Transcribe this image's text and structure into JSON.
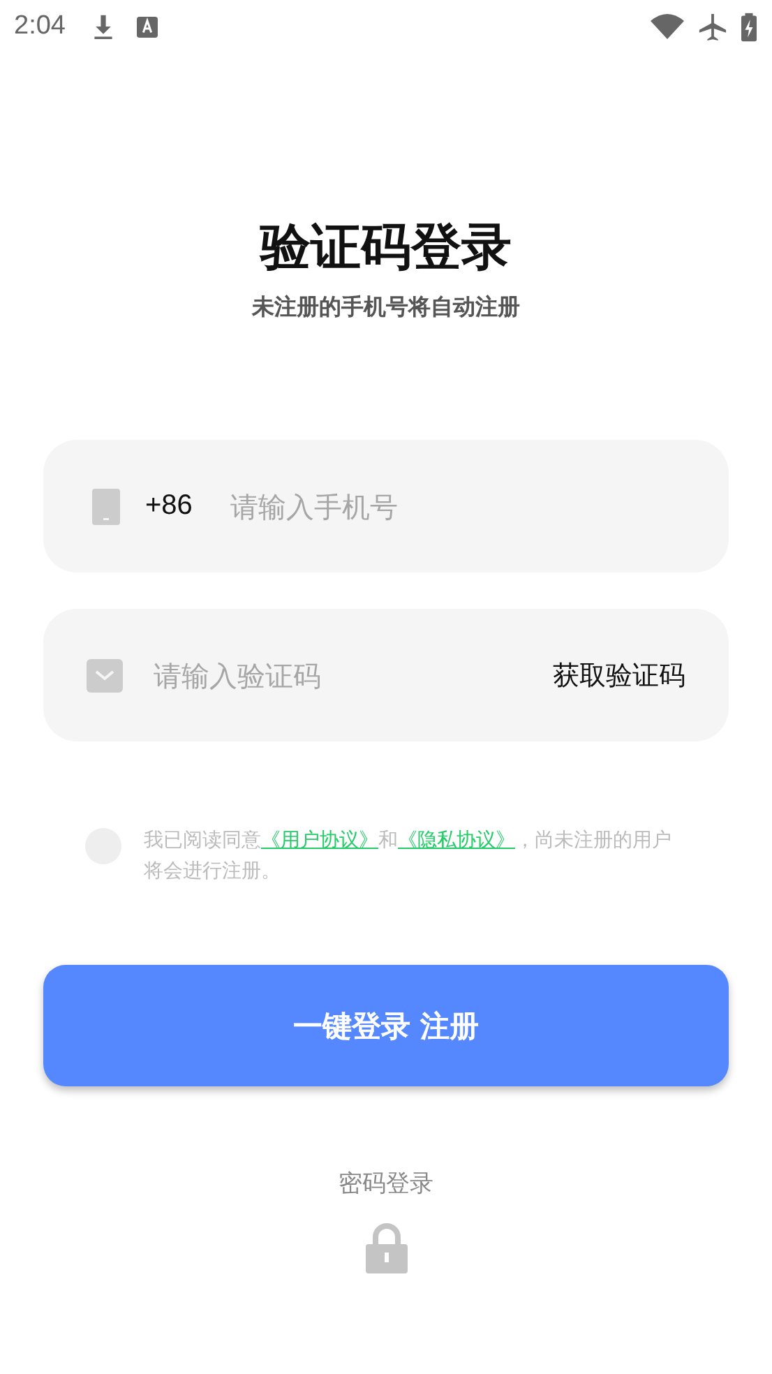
{
  "status_bar": {
    "time": "2:04"
  },
  "title": "验证码登录",
  "subtitle": "未注册的手机号将自动注册",
  "phone_field": {
    "country_code": "+86",
    "placeholder": "请输入手机号"
  },
  "code_field": {
    "placeholder": "请输入验证码",
    "action": "获取验证码"
  },
  "agreement": {
    "checked": false,
    "segments": [
      {
        "kind": "text",
        "text": "我已阅读同意"
      },
      {
        "kind": "link",
        "text": "《用户协议》"
      },
      {
        "kind": "text",
        "text": "和"
      },
      {
        "kind": "link",
        "text": "《隐私协议》"
      },
      {
        "kind": "text",
        "text": "，尚未注册的用户将会进行注册。"
      }
    ]
  },
  "login_button": "一键登录 注册",
  "password_login": "密码登录"
}
